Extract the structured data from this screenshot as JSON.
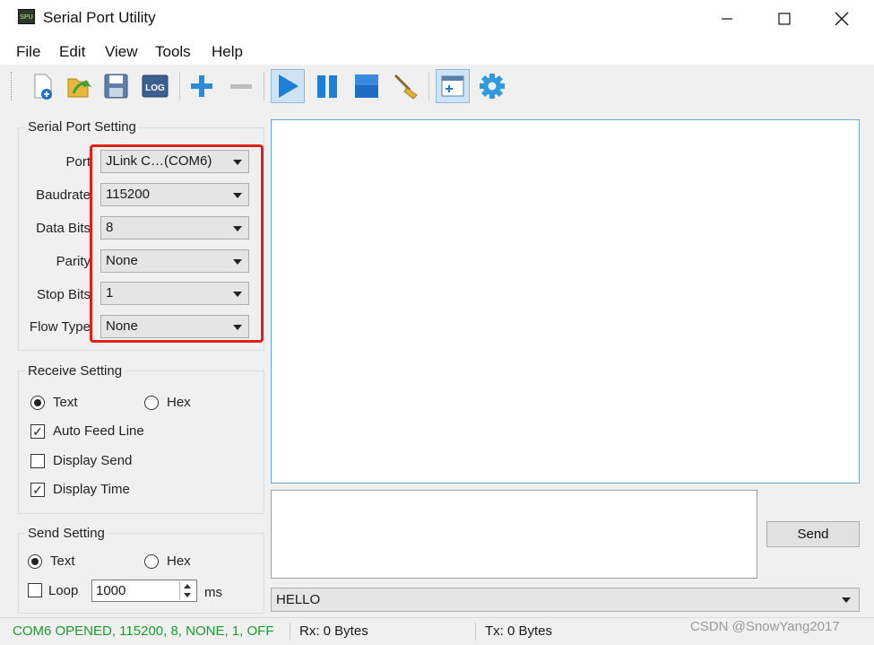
{
  "window": {
    "title": "Serial Port Utility",
    "icon_text": "SPU"
  },
  "menu": [
    {
      "label": "File"
    },
    {
      "label": "Edit"
    },
    {
      "label": "View"
    },
    {
      "label": "Tools"
    },
    {
      "label": "Help"
    }
  ],
  "toolbar": {
    "icons": [
      "new-file-icon",
      "open-folder-icon",
      "save-icon",
      "log-icon",
      "add-icon",
      "remove-icon",
      "start-icon",
      "pause-icon",
      "stop-icon",
      "clear-broom-icon",
      "new-window-icon",
      "settings-gear-icon"
    ],
    "log_label": "LOG"
  },
  "serial_port_setting": {
    "title": "Serial Port Setting",
    "fields": [
      {
        "label": "Port",
        "value": "JLink C…(COM6)"
      },
      {
        "label": "Baudrate",
        "value": "115200"
      },
      {
        "label": "Data Bits",
        "value": "8"
      },
      {
        "label": "Parity",
        "value": "None"
      },
      {
        "label": "Stop Bits",
        "value": "1"
      },
      {
        "label": "Flow Type",
        "value": "None"
      }
    ]
  },
  "receive_setting": {
    "title": "Receive Setting",
    "text_label": "Text",
    "hex_label": "Hex",
    "selected": "Text",
    "auto_feed_line": {
      "label": "Auto Feed Line",
      "checked": true
    },
    "display_send": {
      "label": "Display Send",
      "checked": false
    },
    "display_time": {
      "label": "Display Time",
      "checked": true
    }
  },
  "send_setting": {
    "title": "Send Setting",
    "text_label": "Text",
    "hex_label": "Hex",
    "selected": "Text",
    "loop": {
      "label": "Loop",
      "checked": false
    },
    "interval_value": "1000",
    "interval_unit": "ms"
  },
  "send_button_label": "Send",
  "history_value": "HELLO",
  "status": {
    "connection": "COM6 OPENED, 115200, 8, NONE, 1, OFF",
    "rx": "Rx: 0 Bytes",
    "tx": "Tx: 0 Bytes"
  },
  "watermark": "CSDN @SnowYang2017",
  "colors": {
    "status_ok": "#1a9c2a",
    "highlight_border": "#e0201b",
    "accent_blue": "#1e7fd6"
  }
}
